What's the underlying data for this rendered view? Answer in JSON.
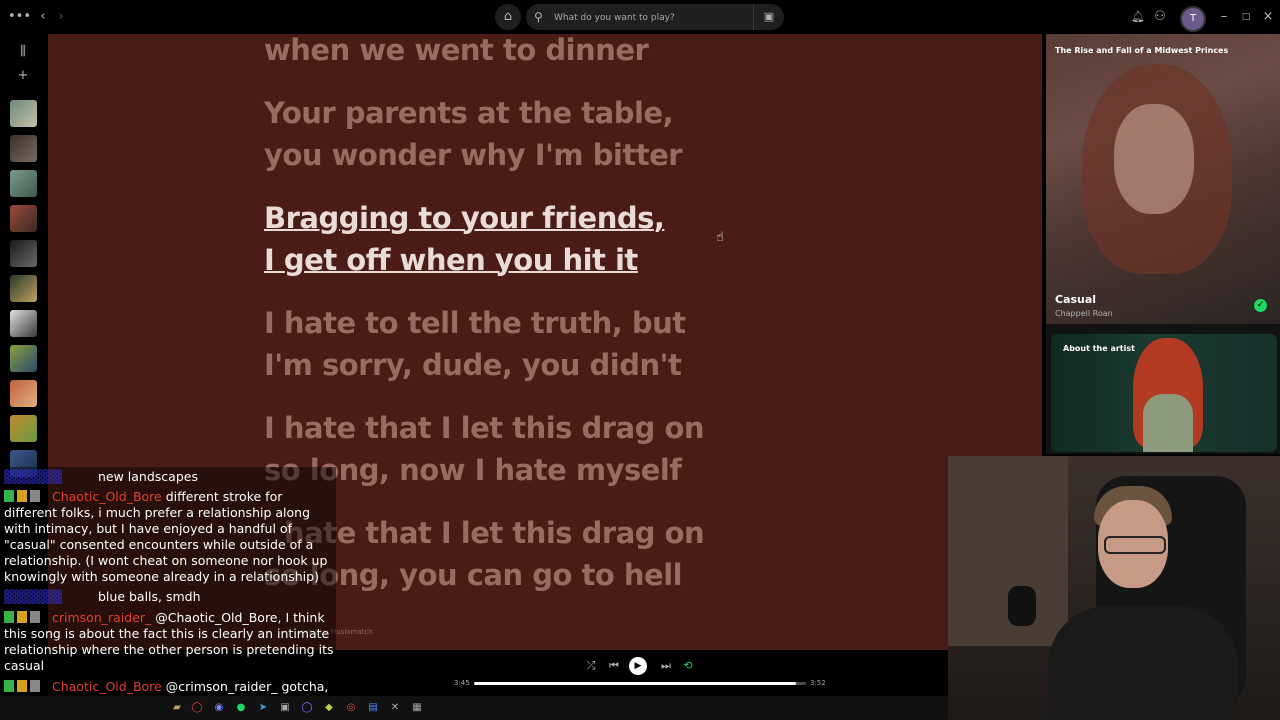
{
  "topbar": {
    "search_placeholder": "What do you want to play?",
    "avatar_initial": "T"
  },
  "lyrics": {
    "lines": [
      "when we went to dinner",
      "Your parents at the table,",
      "you wonder why I'm bitter",
      "Bragging to your friends,",
      "I get off when you hit it",
      "I hate to tell the truth, but",
      "I'm sorry, dude, you didn't",
      "I hate that I let this drag on",
      "so long, now I hate myself",
      "hate that I let this drag on",
      "so long, you can go to hell"
    ],
    "credit": "vided by Musixmatch"
  },
  "now_playing": {
    "playlist_title": "The Rise and Fall of a Midwest Princes",
    "track_title": "Casual",
    "artist": "Chappell Roan",
    "about_label": "About the artist"
  },
  "player": {
    "elapsed": "3:45",
    "total": "3:52",
    "progress_fraction": 0.97
  },
  "chat": {
    "messages": [
      {
        "user": "",
        "text": "new landscapes"
      },
      {
        "user": "Chaotic_Old_Bore",
        "text": "different stroke for different folks, i much prefer a relationship along with intimacy, but I have enjoyed a handful of \"casual\" consented encounters while outside of a relationship. (I wont cheat on someone nor hook up knowingly with someone already in a relationship)"
      },
      {
        "user": "",
        "text": "blue balls, smdh"
      },
      {
        "user": "crimson_raider_",
        "text": "@Chaotic_Old_Bore, I think this song is about the fact this is clearly an intimate relationship where the other person is pretending its casual"
      },
      {
        "user": "Chaotic_Old_Bore",
        "text": "@crimson_raider_ gotcha, that makes sense"
      }
    ]
  },
  "colors": {
    "lyrics_bg": "#4a1c15",
    "accent_green": "#1ed760"
  }
}
